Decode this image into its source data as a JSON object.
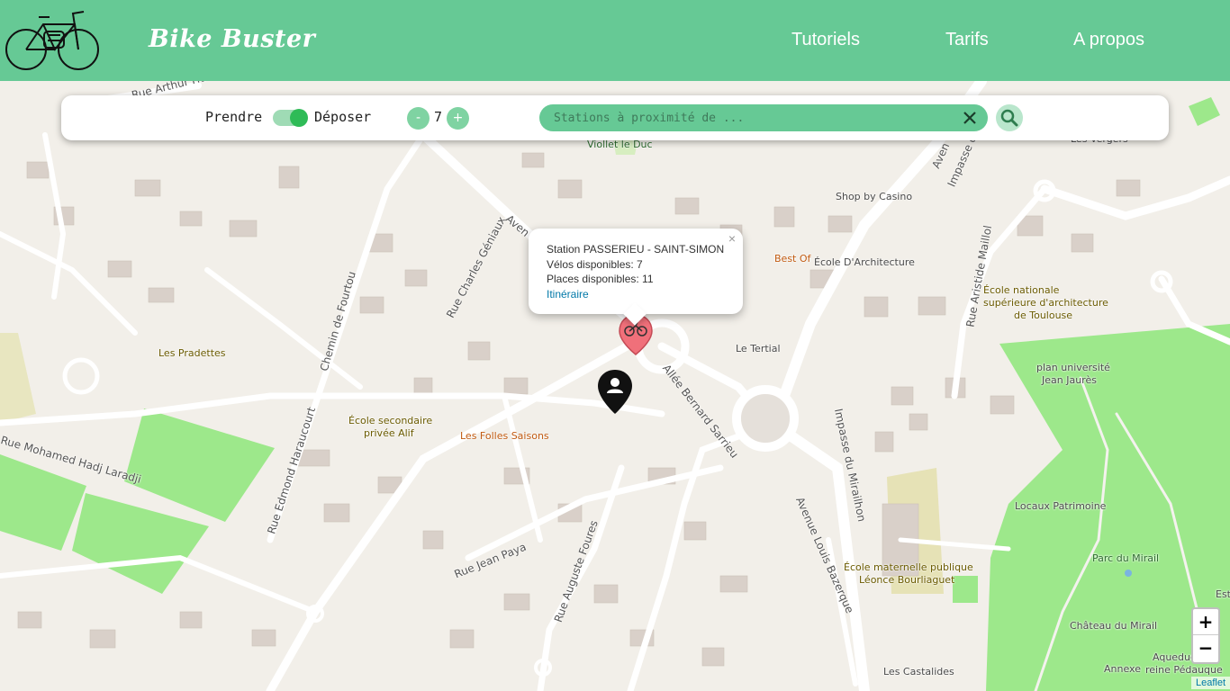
{
  "header": {
    "brand": "Bike Buster",
    "nav": [
      {
        "label": "Tutoriels"
      },
      {
        "label": "Tarifs"
      },
      {
        "label": "A propos"
      }
    ]
  },
  "panel": {
    "take_label": "Prendre",
    "drop_label": "Déposer",
    "toggle_state": "Déposer",
    "minus_label": "-",
    "plus_label": "+",
    "count": "7",
    "search_placeholder": "Stations à proximité de ...",
    "search_value": ""
  },
  "popup": {
    "station": "Station PASSERIEU - SAINT-SIMON",
    "bikes": "Vélos disponibles: 7",
    "places": "Places disponibles: 11",
    "link": "Itinéraire",
    "close": "×"
  },
  "map": {
    "labels": {
      "viollet": "Viollet le Duc",
      "shop": "Shop by Casino",
      "bestof": "Best Of",
      "ecole_arch": "École D'Architecture",
      "ensa1": "École nationale",
      "ensa2": "supérieure d'architecture",
      "ensa3": "de Toulouse",
      "tertial": "Le Tertial",
      "univ1": "plan université",
      "univ2": "Jean Jaurès",
      "pradettes": "Les Pradettes",
      "alif1": "École secondaire",
      "alif2": "privée Alif",
      "folles": "Les Folles Saisons",
      "locaux": "Locaux Patrimoine",
      "parc": "Parc du Mirail",
      "chateau": "Château du Mirail",
      "annexe": "Annexe",
      "aqueduc1": "Aqueduc",
      "aqueduc2": "reine Pédauque",
      "ecole_mat1": "École maternelle publique",
      "ecole_mat2": "Léonce Bourliaguet",
      "castalides": "Les Castalides",
      "vergers": "Les Vergers",
      "est": "Est"
    },
    "roads": {
      "arthur": "Rue Arthur Huc",
      "geniaux": "Rue Charles Géniaux",
      "fourtou": "Chemin de Fourtou",
      "haraucourt": "Rue Edmond Haraucourt",
      "laradji": "Rue Mohamed Hadj Laradji",
      "paya": "Rue Jean Paya",
      "foures": "Rue Auguste Foures",
      "sarrieu": "Allée Bernard Sarrieu",
      "bazerque": "Avenue Louis Bazerque",
      "mirailhon": "Impasse du Mirailhon",
      "maillol": "Rue Aristide Maillol",
      "impasse_le": "Impasse de l'A",
      "avenue_top": "Aven",
      "avenue_right": "Aven"
    }
  },
  "zoom": {
    "in": "+",
    "out": "−"
  },
  "attribution": "Leaflet"
}
